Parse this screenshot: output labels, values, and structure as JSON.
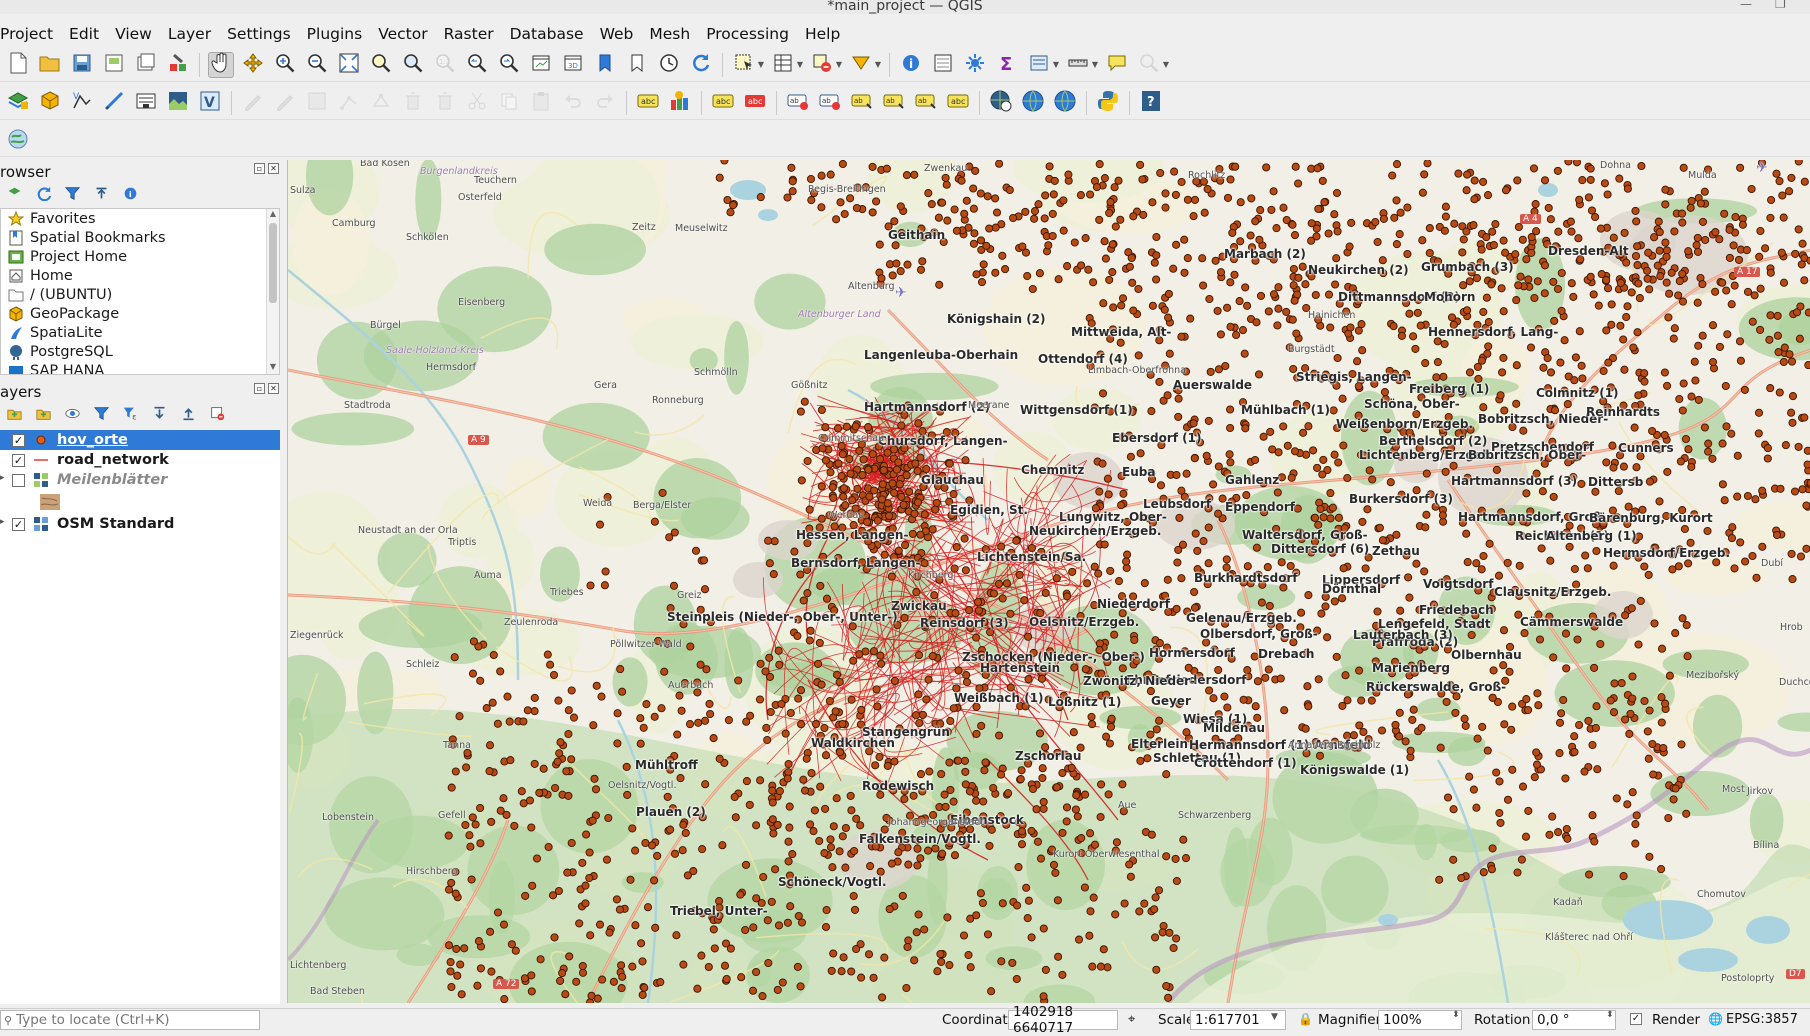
{
  "window": {
    "title": "*main_project — QGIS"
  },
  "menubar": {
    "items": [
      "Project",
      "Edit",
      "View",
      "Layer",
      "Settings",
      "Plugins",
      "Vector",
      "Raster",
      "Database",
      "Web",
      "Mesh",
      "Processing",
      "Help"
    ]
  },
  "browser": {
    "title": "Browser",
    "items": [
      {
        "label": "Favorites",
        "icon": "star-icon"
      },
      {
        "label": "Spatial Bookmarks",
        "icon": "bookmarks-icon"
      },
      {
        "label": "Project Home",
        "icon": "project-home-icon"
      },
      {
        "label": "Home",
        "icon": "home-folder-icon"
      },
      {
        "label": "/ (UBUNTU)",
        "icon": "folder-icon"
      },
      {
        "label": "GeoPackage",
        "icon": "geopackage-icon"
      },
      {
        "label": "SpatiaLite",
        "icon": "spatialite-icon"
      },
      {
        "label": "PostgreSQL",
        "icon": "postgresql-icon"
      },
      {
        "label": "SAP HANA",
        "icon": "sap-hana-icon"
      }
    ]
  },
  "layers": {
    "title": "Layers",
    "items": [
      {
        "name": "hov_orte",
        "checked": true,
        "selected": true,
        "italic": false,
        "icon": "point-layer-icon"
      },
      {
        "name": "road_network",
        "checked": true,
        "selected": false,
        "italic": false,
        "icon": "line-layer-icon"
      },
      {
        "name": "Meilenblätter",
        "checked": false,
        "selected": false,
        "italic": true,
        "icon": "raster-group-icon"
      },
      {
        "name": "",
        "checked": false,
        "selected": false,
        "italic": false,
        "icon": "raster-thumbnail-icon"
      },
      {
        "name": "OSM Standard",
        "checked": true,
        "selected": false,
        "italic": false,
        "icon": "xyz-tile-icon"
      }
    ]
  },
  "map": {
    "point_color": "#b84a14",
    "road_color": "#d62020",
    "place_labels": [
      "Geithain",
      "Marbach (2)",
      "Neukirchen (2)",
      "Grumbach (3)",
      "Dresden-Alt",
      "Dittmannsdorf (2)",
      "Mohorn",
      "Königshain (2)",
      "Mittweida, Alt-",
      "Hennersdorf, Lang-",
      "Langenleuba-Oberhain",
      "Ottendorf (4)",
      "Striegis, Langen-",
      "Freiberg (1)",
      "Colmnitz (1)",
      "Auerswalde",
      "Schöna, Ober-",
      "Hartmannsdorf (2)",
      "Wittgensdorf (1)",
      "Mühlbach (1)",
      "Weißenborn/Erzgeb.",
      "Bobritzsch, Nieder-",
      "Reinhardts",
      "Ebersdorf (1)",
      "Chursdorf, Langen-",
      "Berthelsdorf (2)",
      "Pretzschendorf",
      "Cunners",
      "Lichtenberg/Erzgeb.",
      "Bobritzsch, Ober-",
      "Chemnitz",
      "Euba",
      "Gahlenz",
      "Dittersb",
      "Glauchau",
      "Hartmannsdorf (3)",
      "Leubsdorf",
      "Eppendorf",
      "Burkersdorf (3)",
      "Egidien, St.",
      "Lungwitz, Ober-",
      "Hartmannsdorf, Groß-",
      "Bärenburg, Kurort",
      "Neukirchen/Erzgeb.",
      "Reichenau (1)",
      "Hessen, Langen-",
      "Waltersdorf, Groß-",
      "Zethau",
      "Altenberg (1)",
      "Lichtenstein/Sa.",
      "Dittersdorf (6)",
      "Hermsdorf/Erzgeb.",
      "Bernsdorf, Langen-",
      "Lippersdorf",
      "Burkhardtsdorf",
      "Dörnthal",
      "Voigtsdorf",
      "Clausnitz/Erzgeb.",
      "Zwickau",
      "Niederdorf",
      "Steinpleis (Nieder-, Ober-, Unter-)",
      "Friedebach",
      "Reinsdorf (3)",
      "Oelsnitz/Erzgeb.",
      "Gelenau/Erzgeb.",
      "Lengefeld, Stadt",
      "Cämmerswalde",
      "Olbersdorf, Groß-",
      "Pfaffroda (2)",
      "Lauterbach (3)",
      "Zschocken (Nieder-, Ober-)",
      "Drebach",
      "Hartenstein",
      "Hormersdorf",
      "Olbernhau",
      "Marienberg",
      "Ehrenfriedersdorf",
      "Zwönitz, Nieder-",
      "Weißbach (1)",
      "Geyer",
      "Rückerswalde, Groß-",
      "Lößnitz (1)",
      "Wiesa (1)",
      "Mildenau",
      "Waldkirchen",
      "Stangengrün",
      "Elterlein",
      "Hermannsdorf (1)",
      "Arnsfeld",
      "Zschorlau",
      "Schlettau (1)",
      "Mühltroff",
      "Rodewisch",
      "Königswalde (1)",
      "Crottendorf (1)",
      "Plauen (2)",
      "Eibenstock",
      "Falkenstein/Vogtl.",
      "Schöneck/Vogtl.",
      "Triebel, Unter-"
    ],
    "base_labels": [
      "Bad Kösen",
      "Burgenlandkreis",
      "Teuchern",
      "Sulza",
      "Osterfeld",
      "Camburg",
      "Schkölen",
      "Zeitz",
      "Meuselwitz",
      "Regis-Breitingen",
      "Eisenberg",
      "Bürgel",
      "Altenburg",
      "Altenburger Land",
      "Saale-Holzland-Kreis",
      "Hermsdorf",
      "Schmölln",
      "Gera",
      "Stadtroda",
      "Ronneburg",
      "Gößnitz",
      "Weida",
      "Berga/Elster",
      "Neustadt an der Orla",
      "Triptis",
      "Auma",
      "Triebes",
      "Zeulenroda",
      "Ziegenrück",
      "Pöllwitzer Wald",
      "Greiz",
      "Schleiz",
      "Tanna",
      "Gefell",
      "Hirschberg",
      "Lobenstein",
      "Lichtenberg",
      "Bad Steben",
      "Johanngeorgenstadt",
      "Kurort Oberwiesenthal",
      "Dohna",
      "Mulda",
      "Chomutov",
      "Most",
      "Bílina",
      "Jirkov",
      "Kadaň",
      "Klášterec nad Ohří",
      "Postoloprty",
      "Duchcov",
      "Dubí",
      "Mezibořský",
      "Hrob",
      "Zwenkau",
      "Rochlitz",
      "Hainichen",
      "Burgstädt",
      "Limbach-Oberfrohna",
      "Meerane",
      "Crimmitschau",
      "Werdau",
      "Kirchberg",
      "Aue",
      "Annaberg-Buchholz",
      "Schwarzenberg",
      "Auerbach",
      "Oelsnitz/Vogtl."
    ],
    "road_shields": [
      "A 9",
      "A 4",
      "A 17",
      "A 72",
      "D7"
    ]
  },
  "statusbar": {
    "locator_placeholder": "Type to locate (Ctrl+K)",
    "coordinate_label": "Coordinate",
    "coordinate_value": "1402918  6640717",
    "scale_label": "Scale",
    "scale_value": "1:617701",
    "magnifier_label": "Magnifier",
    "magnifier_value": "100%",
    "rotation_label": "Rotation",
    "rotation_value": "0,0 °",
    "render_label": "Render",
    "render_checked": true,
    "crs_label": "EPSG:3857"
  }
}
